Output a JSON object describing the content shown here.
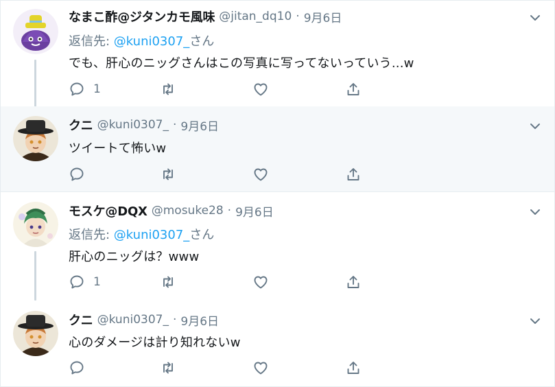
{
  "tweets": [
    {
      "name": "なまこ酢@ジタンカモ風味",
      "handle": "@jitan_dq10",
      "separator": "·",
      "date": "9月6日",
      "reply_prefix": "返信先: ",
      "reply_mention": "@kuni0307_",
      "reply_suffix": "さん",
      "text": "でも、肝心のニッグさんはこの写真に写ってないっていう...w",
      "reply_count": "1",
      "avatar_icon": "purple-slime-avatar"
    },
    {
      "name": "クニ",
      "handle": "@kuni0307_",
      "separator": "·",
      "date": "9月6日",
      "text": "ツイートて怖いw",
      "reply_count": "",
      "avatar_icon": "hat-character-avatar"
    },
    {
      "name": "モスケ@DQX",
      "handle": "@mosuke28",
      "separator": "·",
      "date": "9月6日",
      "reply_prefix": "返信先: ",
      "reply_mention": "@kuni0307_",
      "reply_suffix": "さん",
      "text": "肝心のニッグは？www",
      "reply_count": "1",
      "avatar_icon": "green-hair-character-avatar"
    },
    {
      "name": "クニ",
      "handle": "@kuni0307_",
      "separator": "·",
      "date": "9月6日",
      "text": "心のダメージは計り知れないw",
      "reply_count": "",
      "avatar_icon": "hat-character-avatar"
    }
  ],
  "colors": {
    "link": "#1da1f2",
    "secondary_text": "#657786",
    "highlight_bg": "#f5f8fa",
    "thread_line": "#ccd6dd",
    "divider": "#e6ecf0"
  },
  "icons": [
    "reply-icon",
    "retweet-icon",
    "like-icon",
    "share-icon",
    "chevron-down-icon"
  ]
}
